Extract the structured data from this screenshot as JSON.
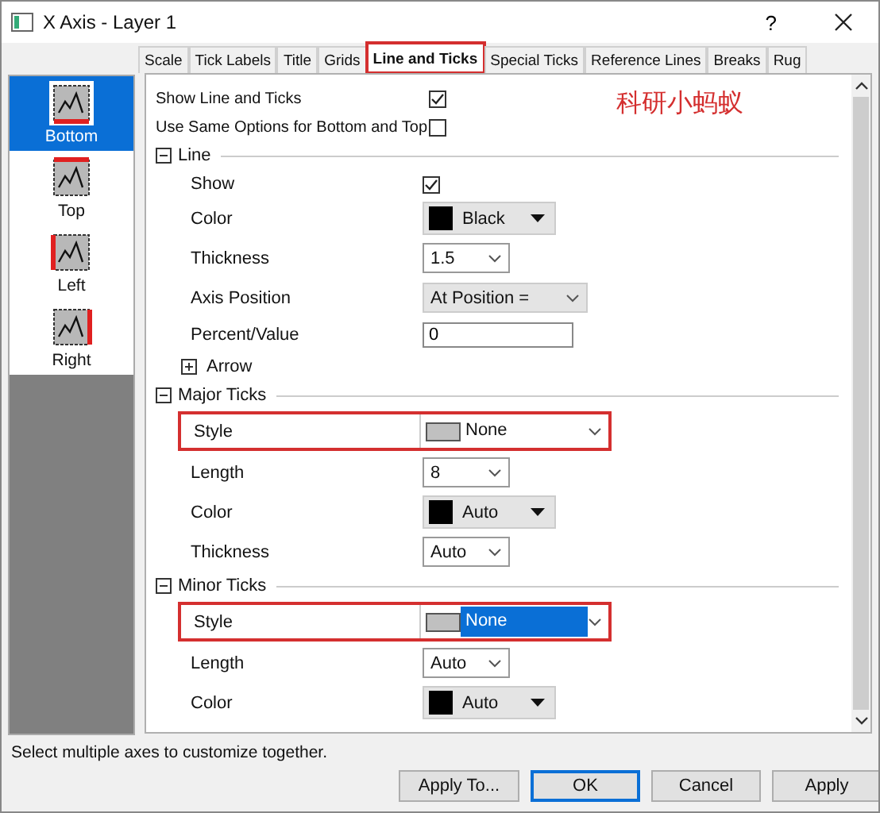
{
  "window": {
    "title": "X Axis - Layer 1",
    "help": "?"
  },
  "tabs": [
    {
      "label": "Scale",
      "selected": false,
      "highlighted": false
    },
    {
      "label": "Tick Labels",
      "selected": false,
      "highlighted": false
    },
    {
      "label": "Title",
      "selected": false,
      "highlighted": false
    },
    {
      "label": "Grids",
      "selected": false,
      "highlighted": false
    },
    {
      "label": "Line and Ticks",
      "selected": true,
      "highlighted": true
    },
    {
      "label": "Special Ticks",
      "selected": false,
      "highlighted": false
    },
    {
      "label": "Reference Lines",
      "selected": false,
      "highlighted": false
    },
    {
      "label": "Breaks",
      "selected": false,
      "highlighted": false
    },
    {
      "label": "Rug",
      "selected": false,
      "highlighted": false
    }
  ],
  "axes": [
    {
      "label": "Bottom",
      "kind": "bottom",
      "selected": true
    },
    {
      "label": "Top",
      "kind": "top",
      "selected": false
    },
    {
      "label": "Left",
      "kind": "left",
      "selected": false
    },
    {
      "label": "Right",
      "kind": "right",
      "selected": false
    }
  ],
  "options": [
    {
      "label": "Show Line and Ticks",
      "checked": true
    },
    {
      "label": "Use Same Options for Bottom and Top",
      "checked": false
    }
  ],
  "annotation": "科研小蚂蚁",
  "groups": [
    {
      "title": "Line",
      "expanded": true,
      "rows": [
        {
          "kind": "check",
          "label": "Show",
          "checked": true
        },
        {
          "kind": "color",
          "label": "Color",
          "value": "Black",
          "color": "#000000"
        },
        {
          "kind": "combo",
          "label": "Thickness",
          "value": "1.5"
        },
        {
          "kind": "wide",
          "label": "Axis Position",
          "value": "At Position ="
        },
        {
          "kind": "text",
          "label": "Percent/Value",
          "value": "0"
        },
        {
          "kind": "expander",
          "label": "Arrow",
          "expanded": false
        }
      ]
    },
    {
      "title": "Major Ticks",
      "expanded": true,
      "rows": [
        {
          "kind": "style",
          "label": "Style",
          "value": "None",
          "highlighted": true,
          "selected": false
        },
        {
          "kind": "combo",
          "label": "Length",
          "value": "8"
        },
        {
          "kind": "color",
          "label": "Color",
          "value": "Auto",
          "color": "#000000"
        },
        {
          "kind": "combo",
          "label": "Thickness",
          "value": "Auto"
        }
      ]
    },
    {
      "title": "Minor Ticks",
      "expanded": true,
      "rows": [
        {
          "kind": "style",
          "label": "Style",
          "value": "None",
          "highlighted": true,
          "selected": true
        },
        {
          "kind": "combo",
          "label": "Length",
          "value": "Auto"
        },
        {
          "kind": "color",
          "label": "Color",
          "value": "Auto",
          "color": "#000000"
        }
      ]
    }
  ],
  "status": "Select multiple axes to customize together.",
  "buttons": [
    {
      "label": "Apply To...",
      "default": false
    },
    {
      "label": "OK",
      "default": true
    },
    {
      "label": "Cancel",
      "default": false
    },
    {
      "label": "Apply",
      "default": false
    }
  ]
}
